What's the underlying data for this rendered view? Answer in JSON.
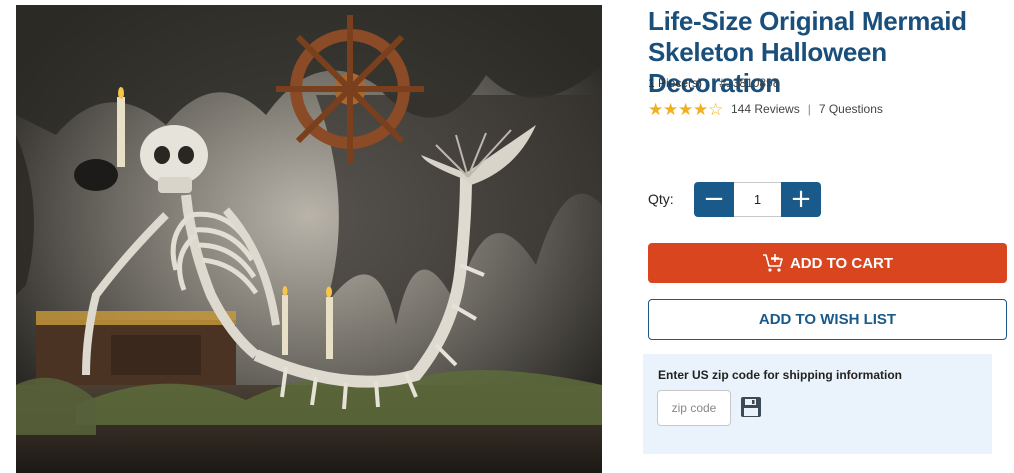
{
  "product": {
    "title": "Life-Size Original Mermaid Skeleton Halloween Decoration",
    "quantity_unit": "1 Piece(s)",
    "sku": "#13810898",
    "rating": 4.5,
    "rating_max": 5,
    "reviews_label": "144 Reviews",
    "questions_label": "7 Questions",
    "image_icon": "mermaid-skeleton-photo"
  },
  "purchase": {
    "qty_label": "Qty:",
    "qty_value": "1",
    "minus_symbol": "−",
    "plus_symbol": "+",
    "add_to_cart_label": "ADD TO CART",
    "wish_list_label": "ADD TO WISH LIST"
  },
  "shipping": {
    "title": "Enter US zip code for shipping information",
    "zip_placeholder": "zip code",
    "save_icon": "save-icon"
  },
  "colors": {
    "title_blue": "#1a4f7c",
    "button_blue": "#1a5a8a",
    "cart_orange": "#d8451e",
    "star_gold": "#f2b01e",
    "shipping_bg": "#eaf3fb"
  }
}
